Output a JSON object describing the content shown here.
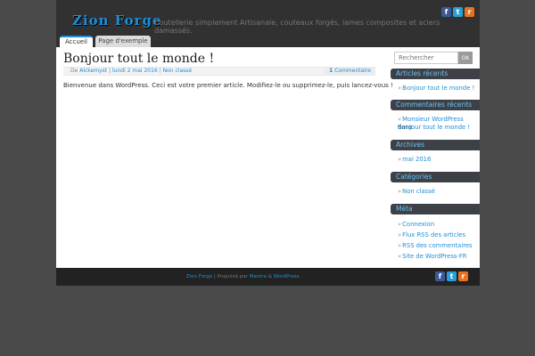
{
  "header": {
    "site_title": "Zion Forge",
    "site_description": "Coutellerie simplement Artisanale, couteaux forgés, lames composites et aciers damassés."
  },
  "social": {
    "facebook": "f",
    "twitter": "t",
    "rss": "r"
  },
  "nav": {
    "tabs": [
      {
        "label": "Accueil"
      },
      {
        "label": "Page d'exemple"
      }
    ]
  },
  "post": {
    "title": "Bonjour tout le monde !",
    "meta": {
      "by": "De",
      "author": "Alckemyst",
      "sep": "|",
      "date": "lundi 2 mai 2016",
      "category": "Non classé"
    },
    "comments": {
      "count": "1",
      "label": "Commentaire"
    },
    "body": "Bienvenue dans WordPress. Ceci est votre premier article. Modifiez-le ou supprimez-le, puis lancez-vous !"
  },
  "sidebar": {
    "search": {
      "placeholder": "Rechercher",
      "button": "OK"
    },
    "widgets": {
      "recent_posts": {
        "title": "Articles récents",
        "items": [
          "Bonjour tout le monde !"
        ]
      },
      "recent_comments": {
        "title": "Commentaires récents",
        "author": "Monsieur WordPress",
        "on": "dans",
        "post": "Bonjour tout le monde !"
      },
      "archives": {
        "title": "Archives",
        "items": [
          "mai 2016"
        ]
      },
      "categories": {
        "title": "Catégories",
        "items": [
          "Non classé"
        ]
      },
      "meta": {
        "title": "Méta",
        "items": [
          "Connexion",
          "Flux RSS des articles",
          "RSS des commentaires",
          "Site de WordPress-FR"
        ]
      }
    }
  },
  "footer": {
    "site": "Zion Forge",
    "sep": "|",
    "powered": "Propulsé par",
    "theme": "Mantra",
    "and": "&",
    "wp": "WordPress."
  },
  "colors": {
    "accent": "#1e8ed8",
    "background": "#4a4a4a",
    "header": "#313131",
    "widget_title_bg": "#3d4147"
  }
}
